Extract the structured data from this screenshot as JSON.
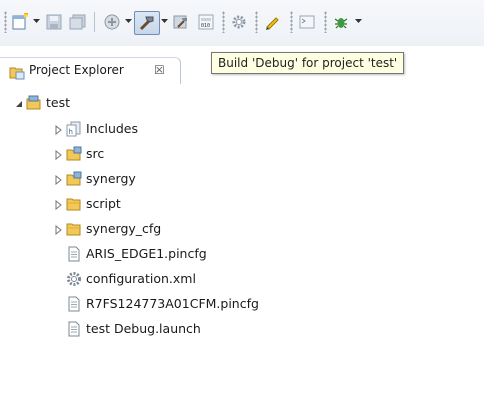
{
  "toolbar": {
    "items": [
      {
        "name": "new-icon"
      },
      {
        "name": "save-icon"
      },
      {
        "name": "save-all-icon"
      },
      {
        "name": "debug-config-icon"
      },
      {
        "name": "build-hammer-icon"
      },
      {
        "name": "build-all-icon"
      },
      {
        "name": "binary-icon"
      },
      {
        "name": "settings-gear-icon"
      },
      {
        "name": "pencil-icon"
      },
      {
        "name": "terminal-icon"
      },
      {
        "name": "bug-icon"
      }
    ]
  },
  "tooltip": {
    "text": "Build 'Debug' for project 'test'"
  },
  "view": {
    "tab_label": "Project Explorer",
    "close_glyph": "☒"
  },
  "tree": {
    "root": {
      "label": "test",
      "icon": "project-folder-icon",
      "expanded": true
    },
    "children": [
      {
        "label": "Includes",
        "icon": "includes-icon",
        "expandable": true
      },
      {
        "label": "src",
        "icon": "source-folder-icon",
        "expandable": true
      },
      {
        "label": "synergy",
        "icon": "source-folder-icon",
        "expandable": true
      },
      {
        "label": "script",
        "icon": "folder-icon",
        "expandable": true
      },
      {
        "label": "synergy_cfg",
        "icon": "folder-icon",
        "expandable": true
      },
      {
        "label": "ARIS_EDGE1.pincfg",
        "icon": "file-icon",
        "expandable": false
      },
      {
        "label": "configuration.xml",
        "icon": "config-gear-icon",
        "expandable": false
      },
      {
        "label": "R7FS124773A01CFM.pincfg",
        "icon": "file-icon",
        "expandable": false
      },
      {
        "label": "test Debug.launch",
        "icon": "file-icon",
        "expandable": false
      }
    ]
  },
  "colors": {
    "tooltip_bg": "#ffffe1",
    "folder": "#f3c85a",
    "toolbar_bg": "#eef1f6"
  }
}
